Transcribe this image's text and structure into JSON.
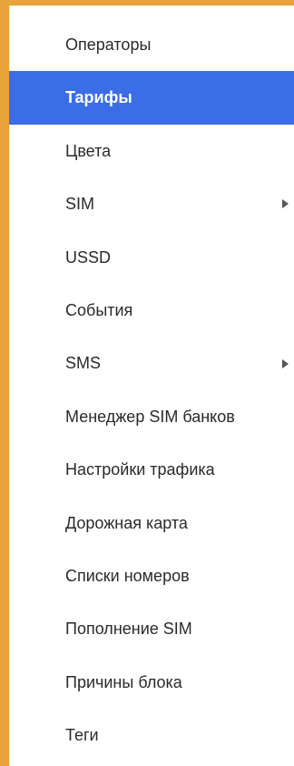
{
  "menu": {
    "items": [
      {
        "label": "Операторы",
        "selected": false,
        "has_submenu": false
      },
      {
        "label": "Тарифы",
        "selected": true,
        "has_submenu": false
      },
      {
        "label": "Цвета",
        "selected": false,
        "has_submenu": false
      },
      {
        "label": "SIM",
        "selected": false,
        "has_submenu": true
      },
      {
        "label": "USSD",
        "selected": false,
        "has_submenu": false
      },
      {
        "label": "События",
        "selected": false,
        "has_submenu": false
      },
      {
        "label": "SMS",
        "selected": false,
        "has_submenu": true
      },
      {
        "label": "Менеджер SIM банков",
        "selected": false,
        "has_submenu": false
      },
      {
        "label": "Настройки трафика",
        "selected": false,
        "has_submenu": false
      },
      {
        "label": "Дорожная карта",
        "selected": false,
        "has_submenu": false
      },
      {
        "label": "Списки номеров",
        "selected": false,
        "has_submenu": false
      },
      {
        "label": "Пополнение SIM",
        "selected": false,
        "has_submenu": false
      },
      {
        "label": "Причины блока",
        "selected": false,
        "has_submenu": false
      },
      {
        "label": "Теги",
        "selected": false,
        "has_submenu": false
      }
    ]
  },
  "colors": {
    "selection": "#3b6de6",
    "frame_accent": "#e8a23a",
    "text": "#2a2a2a"
  },
  "icons": {
    "submenu": "triangle-right-icon"
  }
}
